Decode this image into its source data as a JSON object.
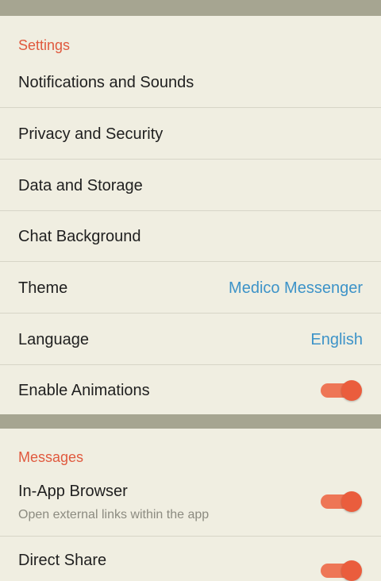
{
  "sections": {
    "settings": {
      "header": "Settings",
      "items": [
        {
          "label": "Notifications and Sounds"
        },
        {
          "label": "Privacy and Security"
        },
        {
          "label": "Data and Storage"
        },
        {
          "label": "Chat Background"
        },
        {
          "label": "Theme",
          "value": "Medico Messenger"
        },
        {
          "label": "Language",
          "value": "English"
        },
        {
          "label": "Enable Animations",
          "toggle": true
        }
      ]
    },
    "messages": {
      "header": "Messages",
      "items": [
        {
          "label": "In-App Browser",
          "subtitle": "Open external links within the app",
          "toggle": true
        },
        {
          "label": "Direct Share",
          "toggle": true
        }
      ]
    }
  },
  "colors": {
    "background": "#f0eee1",
    "divider_band": "#a6a591",
    "section_header": "#e0593e",
    "value_text": "#3d93c8",
    "toggle_on": "#ea5d3d"
  }
}
